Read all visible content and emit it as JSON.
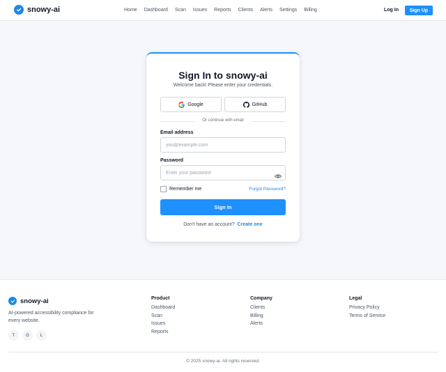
{
  "header": {
    "brand": "snowy-ai",
    "nav": [
      "Home",
      "Dashboard",
      "Scan",
      "Issues",
      "Reports",
      "Clients",
      "Alerts",
      "Settings",
      "Billing"
    ],
    "login_label": "Log In",
    "signup_label": "Sign Up"
  },
  "signin": {
    "title": "Sign In to snowy-ai",
    "subtitle": "Welcome back! Please enter your credentials.",
    "google_label": "Google",
    "github_label": "GitHub",
    "divider_text": "Or continue with email",
    "email_label": "Email address",
    "email_placeholder": "you@example.com",
    "email_value": "",
    "password_label": "Password",
    "password_placeholder": "Enter your password",
    "password_value": "",
    "remember_label": "Remember me",
    "remember_checked": false,
    "forgot_label": "Forgot Password?",
    "submit_label": "Sign In",
    "no_account_text": "Don't have an account?",
    "create_label": "Create one"
  },
  "footer": {
    "brand": "snowy-ai",
    "tagline": "AI-powered accessibility compliance for every website.",
    "socials": [
      "T",
      "G",
      "L"
    ],
    "columns": [
      {
        "title": "Product",
        "links": [
          "Dashboard",
          "Scan",
          "Issues",
          "Reports"
        ]
      },
      {
        "title": "Company",
        "links": [
          "Clients",
          "Billing",
          "Alerts"
        ]
      },
      {
        "title": "Legal",
        "links": [
          "Privacy Policy",
          "Terms of Service"
        ]
      }
    ],
    "copyright": "© 2025 snowy-ai. All rights reserved."
  },
  "colors": {
    "accent": "#1e90ff",
    "link": "#1e88e5",
    "page_bg": "#f5f7fb"
  },
  "icons": {
    "brand": "check-circle-icon",
    "google": "google-icon",
    "github": "github-icon",
    "password_toggle": "eye-icon"
  }
}
